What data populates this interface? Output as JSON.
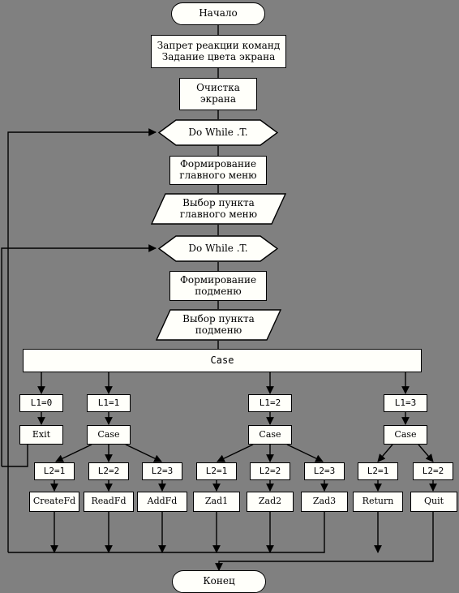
{
  "diagram": {
    "title_start": "Начало",
    "title_end": "Конец",
    "background_color": "#808080",
    "node_fill": "#fffffa",
    "line_color": "#000000"
  },
  "nodes": {
    "start": {
      "label": "Начало",
      "shape": "terminal"
    },
    "init": {
      "label": "Запрет реакции команд\nЗадание цвета экрана",
      "shape": "process"
    },
    "clear": {
      "label": "Очистка\nэкрана",
      "shape": "process"
    },
    "loop1": {
      "label": "Do While .T.",
      "shape": "hexagon"
    },
    "mainmenu_build": {
      "label": "Формирование\nглавного меню",
      "shape": "process"
    },
    "mainmenu_select": {
      "label": "Выбор пункта\nглавного меню",
      "shape": "parallelogram"
    },
    "loop2": {
      "label": "Do While .T.",
      "shape": "hexagon"
    },
    "submenu_build": {
      "label": "Формирование\nподменю",
      "shape": "process"
    },
    "submenu_select": {
      "label": "Выбор пункта\nподменю",
      "shape": "parallelogram"
    },
    "case_main": {
      "label": "Case",
      "shape": "bar"
    },
    "end": {
      "label": "Конец",
      "shape": "terminal"
    }
  },
  "branches_l1": [
    {
      "label": "L1=0"
    },
    {
      "label": "L1=1"
    },
    {
      "label": "L1=2"
    },
    {
      "label": "L1=3"
    }
  ],
  "level2": [
    {
      "label": "Exit"
    },
    {
      "label": "Case"
    },
    {
      "label": "Case"
    },
    {
      "label": "Case"
    }
  ],
  "branches_l2": [
    {
      "label": "L2=1"
    },
    {
      "label": "L2=2"
    },
    {
      "label": "L2=3"
    },
    {
      "label": "L2=1"
    },
    {
      "label": "L2=2"
    },
    {
      "label": "L2=3"
    },
    {
      "label": "L2=1"
    },
    {
      "label": "L2=2"
    }
  ],
  "actions": [
    {
      "label": "CreateFd"
    },
    {
      "label": "ReadFd"
    },
    {
      "label": "AddFd"
    },
    {
      "label": "Zad1"
    },
    {
      "label": "Zad2"
    },
    {
      "label": "Zad3"
    },
    {
      "label": "Return"
    },
    {
      "label": "Quit"
    }
  ]
}
